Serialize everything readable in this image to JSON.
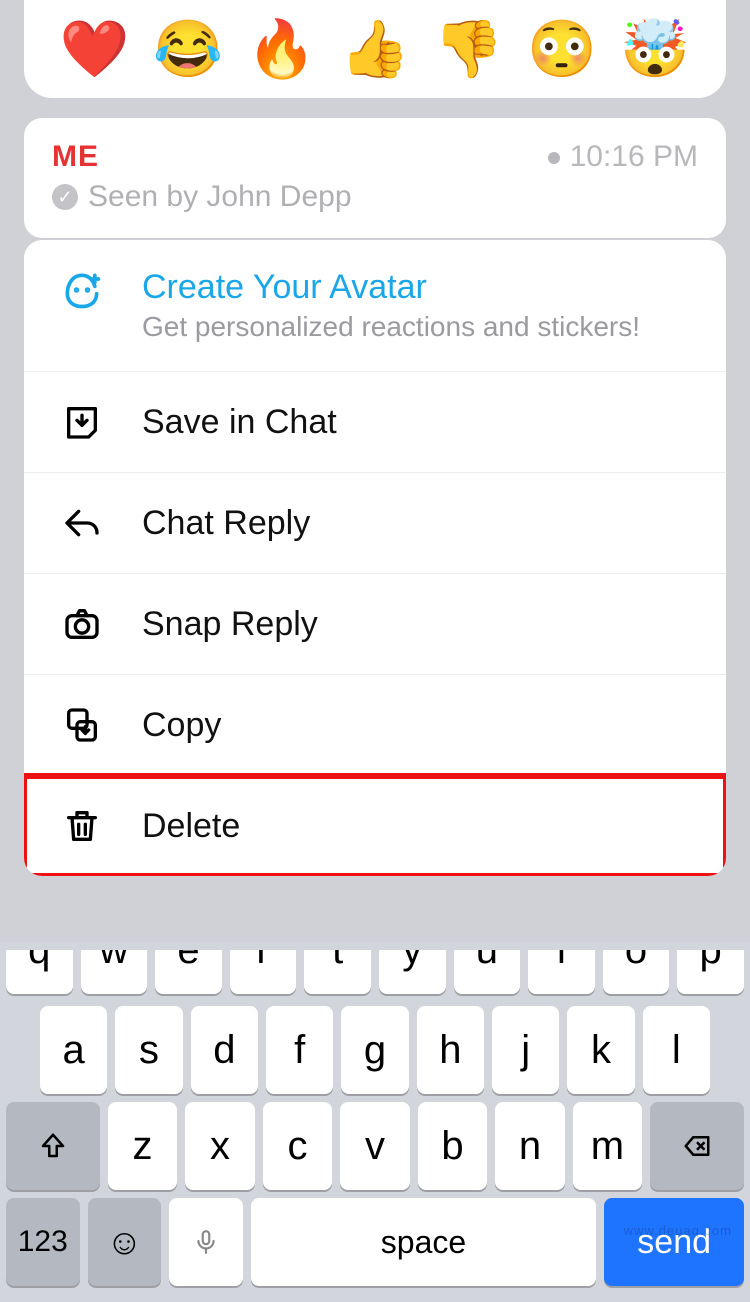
{
  "reactions": {
    "items": [
      "❤️",
      "😂",
      "🔥",
      "👍",
      "👎",
      "😳",
      "🤯"
    ]
  },
  "message": {
    "from": "ME",
    "time": "10:16 PM",
    "seen_by": "Seen by John Depp"
  },
  "avatar_promo": {
    "title": "Create Your Avatar",
    "subtitle": "Get personalized reactions and stickers!"
  },
  "menu": {
    "save": "Save in Chat",
    "chat_reply": "Chat Reply",
    "snap_reply": "Snap Reply",
    "copy": "Copy",
    "delete": "Delete"
  },
  "keyboard": {
    "row_partial": [
      "q",
      "w",
      "e",
      "r",
      "t",
      "y",
      "u",
      "i",
      "o",
      "p"
    ],
    "row2": [
      "a",
      "s",
      "d",
      "f",
      "g",
      "h",
      "j",
      "k",
      "l"
    ],
    "row3": [
      "z",
      "x",
      "c",
      "v",
      "b",
      "n",
      "m"
    ],
    "num": "123",
    "space": "space",
    "send": "send"
  },
  "watermark": "www.deuaq.com"
}
